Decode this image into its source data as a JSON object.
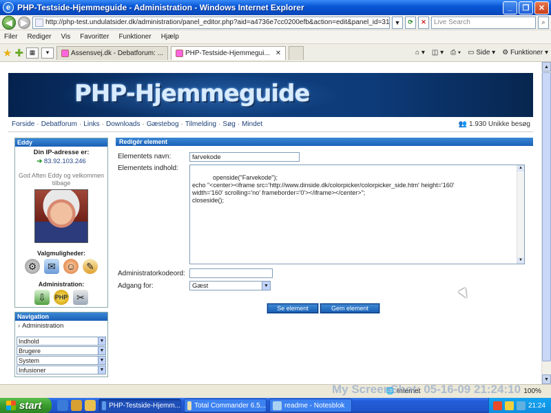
{
  "window": {
    "title": "PHP-Testside-Hjemmeguide - Administration - Windows Internet Explorer",
    "minimize_glyph": "_",
    "maximize_glyph": "❐",
    "close_glyph": "✕"
  },
  "address_bar": {
    "url": "http://php-test.undulatsider.dk/administration/panel_editor.php?aid=a4736e7cc0200efb&action=edit&panel_id=31&panel_s",
    "search_placeholder": "Live Search"
  },
  "menu": [
    "Filer",
    "Rediger",
    "Vis",
    "Favoritter",
    "Funktioner",
    "Hjælp"
  ],
  "tabs": [
    {
      "label": "Assensvej.dk - Debatforum: ...",
      "active": false
    },
    {
      "label": "PHP-Testside-Hjemmegui...",
      "active": true
    }
  ],
  "toolbar_right": {
    "page_label": "Side",
    "tools_label": "Funktioner"
  },
  "site": {
    "logo": "PHP-Hjemmeguide",
    "nav": [
      "Forside",
      "Debatforum",
      "Links",
      "Downloads",
      "Gæstebog",
      "Tilmelding",
      "Søg",
      "Mindet"
    ],
    "visitors": "1.930 Unikke besøg"
  },
  "user_panel": {
    "title": "Eddy",
    "ip_label": "Din IP-adresse er:",
    "ip_value": "83.92.103.246",
    "greeting": "God Aften Eddy og velkommen tilbage",
    "options_label": "Valgmuligheder:",
    "admin_label": "Administration:",
    "option_icons": [
      "gear-icon",
      "mail-icon",
      "users-icon",
      "messages-icon"
    ],
    "admin_icons": [
      "download-icon",
      "php-icon",
      "tools-icon"
    ]
  },
  "navigation_panel": {
    "title": "Navigation",
    "items": [
      "Administration"
    ],
    "selects": [
      "Indhold",
      "Brugere",
      "System",
      "Infusioner"
    ]
  },
  "editor": {
    "header": "Redigér element",
    "name_label": "Elementets navn:",
    "name_value": "farvekode",
    "content_label": "Elementets indhold:",
    "content_value": "openside(\"Farvekode\");\necho \"<center><iframe src='http://www.dinside.dk/colorpicker/colorpicker_side.htm' height='160'\nwidth='160' scrolling='no' frameborder='0'></iframe></center>\";\ncloseside();",
    "password_label": "Administratorkodeord:",
    "password_value": "",
    "access_label": "Adgang for:",
    "access_value": "Gæst",
    "view_button": "Se element",
    "save_button": "Gem element"
  },
  "statusbar": {
    "zone": "Internet",
    "zoom": "100%",
    "watermark": "My ScreenShot: 05-16-09 21:24:10"
  },
  "taskbar": {
    "start": "start",
    "tasks": [
      {
        "label": "PHP-Testside-Hjemm...",
        "active": true
      },
      {
        "label": "Total Commander 6.5...",
        "active": false
      },
      {
        "label": "readme - Notesblok",
        "active": false
      }
    ],
    "clock": "21:24"
  },
  "colors": {
    "xp_blue": "#245edb",
    "panel_header": "#1a60b8",
    "banner": "#0f3f7e"
  }
}
